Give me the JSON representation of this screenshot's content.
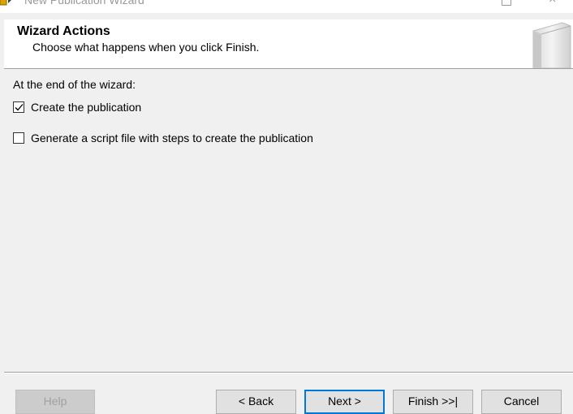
{
  "window": {
    "title": "New Publication Wizard",
    "icon": "wizard-app-icon",
    "controls": [
      "maximize-icon",
      "close-icon"
    ],
    "close_glyph": "×"
  },
  "header": {
    "title": "Wizard Actions",
    "subtitle": "Choose what happens when you click Finish.",
    "graphic": "book-graphic-icon"
  },
  "main": {
    "section_label": "At the end of the wizard:",
    "options": [
      {
        "label": "Create the publication",
        "checked": true
      },
      {
        "label": "Generate a script file with steps to create the publication",
        "checked": false
      }
    ]
  },
  "footer": {
    "help_label": "Help",
    "back_label": "< Back",
    "next_label": "Next >",
    "finish_label": "Finish >>|",
    "cancel_label": "Cancel"
  },
  "colors": {
    "background": "#f0f0f0",
    "header_bg": "#ffffff",
    "default_button_border": "#0078d7",
    "disabled_text": "#a0a0a0"
  }
}
